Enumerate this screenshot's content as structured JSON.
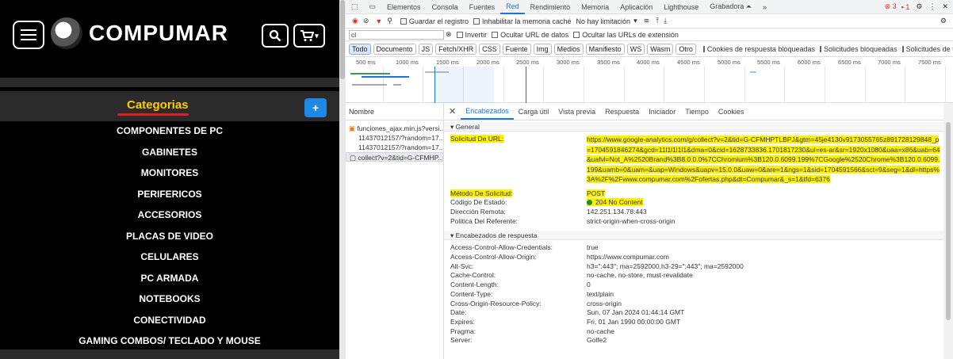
{
  "site": {
    "logo_text": "COMPUMAR",
    "categories_title": "Categorias",
    "plus_label": "+",
    "categories": [
      "COMPONENTES DE PC",
      "GABINETES",
      "MONITORES",
      "PERIFERICOS",
      "ACCESORIOS",
      "PLACAS DE VIDEO",
      "CELULARES",
      "PC ARMADA",
      "NOTEBOOKS",
      "CONECTIVIDAD",
      "GAMING COMBOS/ TECLADO Y MOUSE"
    ],
    "search_icon": "search-icon",
    "cart_icon": "cart-icon",
    "cart_label": "▾"
  },
  "devtools": {
    "main_tabs": [
      "Elementos",
      "Consola",
      "Fuentes",
      "Red",
      "Rendimiento",
      "Memoria",
      "Aplicación",
      "Lighthouse",
      "Grabadora ⏶",
      "»"
    ],
    "active_tab": "Red",
    "status_badges": {
      "errors": "3",
      "warnings": "1"
    },
    "toolbar": {
      "preserve": "Guardar el registro",
      "disable_cache": "Inhabilitar la memoria caché",
      "throttle": "No hay limitación"
    },
    "filter": {
      "value": "cl",
      "invert": "Invertir",
      "hide_data": "Ocultar URL de datos",
      "hide_ext": "Ocultar las URLs de extensión"
    },
    "type_filters": [
      "Todo",
      "Documento",
      "JS",
      "Fetch/XHR",
      "CSS",
      "Fuente",
      "Img",
      "Medios",
      "Manifiesto",
      "WS",
      "Wasm",
      "Otro"
    ],
    "extra_filters": [
      "Cookies de respuesta bloqueadas",
      "Solicitudes bloqueadas",
      "Solicitudes de terceros"
    ],
    "timeline_ticks": [
      "500 ms",
      "1000 ms",
      "1500 ms",
      "2000 ms",
      "2500 ms",
      "3000 ms",
      "3500 ms",
      "4000 ms",
      "4500 ms",
      "5000 ms",
      "5500 ms",
      "6000 ms",
      "6500 ms",
      "7000 ms",
      "7500 ms"
    ],
    "name_header": "Nombre",
    "requests": [
      "funciones_ajax.min.js?versi...",
      "11437012157/?random=17...",
      "11437012157/?random=17...",
      "collect?v=2&tid=G-CFMHP..."
    ],
    "detail_tabs": [
      "Encabezados",
      "Carga útil",
      "Vista previa",
      "Respuesta",
      "Iniciador",
      "Tiempo",
      "Cookies"
    ],
    "general_title": "▾ General",
    "general": [
      {
        "k": "Solicitud De URL:",
        "v": "https://www.google-analytics.com/g/collect?v=2&tid=G-CFMHPTLBPJ&gtm=45je4130v9173055765z891728129848_p=1704591846274&gcd=11l1l1l1l1&dma=0&cid=1628733836.1701817230&ul=es-ar&sr=1920x1080&uaa=x86&uab=64&uafvl=Not_A%2520Brand%3B8.0.0.0%7CChromium%3B120.0.6099.199%7CGoogle%2520Chrome%3B120.0.6099.199&uamb=0&uam=&uap=Windows&uapv=15.0.0&uaw=0&are=1&ngs=1&sid=1704591566&sct=9&seg=1&dl=https%3A%2F%2Fwww.compumar.com%2Fofertas.php&dt=Compumar&_s=1&tfd=6376",
        "hl": true
      },
      {
        "k": "Método De Solicitud:",
        "v": "POST",
        "hl": true
      },
      {
        "k": "Código De Estado:",
        "v": "204 No Content",
        "hl": true
      },
      {
        "k": "Dirección Remota:",
        "v": "142.251.134.78:443",
        "hl": false
      },
      {
        "k": "Política Del Referente:",
        "v": "strict-origin-when-cross-origin",
        "hl": false
      }
    ],
    "response_title": "▾ Encabezados de respuesta",
    "response": [
      {
        "k": "Access-Control-Allow-Credentials:",
        "v": "true"
      },
      {
        "k": "Access-Control-Allow-Origin:",
        "v": "https://www.compumar.com"
      },
      {
        "k": "Alt-Svc:",
        "v": "h3=\":443\"; ma=2592000,h3-29=\":443\"; ma=2592000"
      },
      {
        "k": "Cache-Control:",
        "v": "no-cache, no-store, must-revalidate"
      },
      {
        "k": "Content-Length:",
        "v": "0"
      },
      {
        "k": "Content-Type:",
        "v": "text/plain"
      },
      {
        "k": "Cross-Origin-Resource-Policy:",
        "v": "cross-origin"
      },
      {
        "k": "Date:",
        "v": "Sun, 07 Jan 2024 01:44:14 GMT"
      },
      {
        "k": "Expires:",
        "v": "Fri, 01 Jan 1990 00:00:00 GMT"
      },
      {
        "k": "Pragma:",
        "v": "no-cache"
      },
      {
        "k": "Server:",
        "v": "Golfe2"
      }
    ]
  }
}
